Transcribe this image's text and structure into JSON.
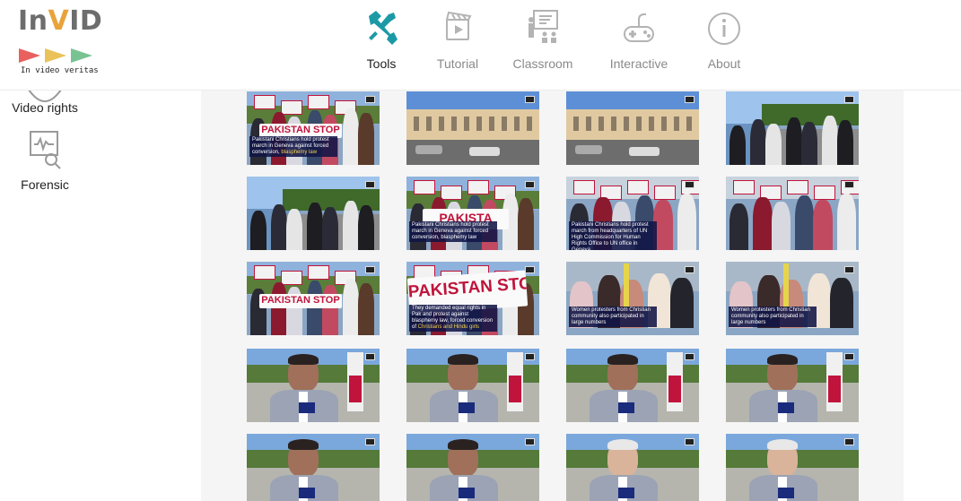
{
  "logo": {
    "title_prefix": "In",
    "title_highlight": "V",
    "title_suffix": "ID",
    "tagline": "In video veritas",
    "arrow_colors": [
      "#e8615f",
      "#e9c35a",
      "#79c393"
    ]
  },
  "nav": {
    "items": [
      {
        "label": "Tools",
        "icon": "tools-icon",
        "active": true
      },
      {
        "label": "Tutorial",
        "icon": "tutorial-icon",
        "active": false
      },
      {
        "label": "Classroom",
        "icon": "classroom-icon",
        "active": false
      },
      {
        "label": "Interactive",
        "icon": "gamepad-icon",
        "active": false
      },
      {
        "label": "About",
        "icon": "info-icon",
        "active": false
      }
    ],
    "active_color": "#1b9aa6",
    "inactive_color": "#b3b3b3"
  },
  "sidebar": {
    "items": [
      {
        "label": "Video rights",
        "icon": "video-rights-icon"
      },
      {
        "label": "Forensic",
        "icon": "forensic-icon"
      }
    ]
  },
  "thumbnails": [
    {
      "kind": "protest",
      "banner": "PAKISTAN STOP",
      "caption_white": "Pakistani Christians hold protest march in Geneva against forced conversion, ",
      "caption_yellow": "blasphemy law"
    },
    {
      "kind": "palace"
    },
    {
      "kind": "palace"
    },
    {
      "kind": "lake-march"
    },
    {
      "kind": "lake"
    },
    {
      "kind": "banner-crowd",
      "banner": "PAKISTA",
      "caption_white": "Pakistani Christians hold protest march in Geneva against forced conversion, blasphemy law"
    },
    {
      "kind": "signs-crowd",
      "caption_white": "Pakistani Christians hold protest march from headquarters of UN High Commission for Human Rights Office to UN office in Geneva"
    },
    {
      "kind": "signs-crowd"
    },
    {
      "kind": "protest",
      "banner": "PAKISTAN STOP"
    },
    {
      "kind": "banner-close",
      "banner": "PAKISTAN STOP",
      "caption_white": "They demanded equal rights in Pak and protest against blasphemy law, forced conversion of ",
      "caption_yellow": "Christians and Hindu girls"
    },
    {
      "kind": "women",
      "caption_white": "Women protesters from Christian community also participated in large numbers"
    },
    {
      "kind": "women",
      "caption_white": "Women protesters from Christian community also participated in large numbers"
    },
    {
      "kind": "interview"
    },
    {
      "kind": "interview"
    },
    {
      "kind": "interview"
    },
    {
      "kind": "interview"
    },
    {
      "kind": "interview2"
    },
    {
      "kind": "interview2"
    },
    {
      "kind": "interview3"
    },
    {
      "kind": "interview3"
    }
  ]
}
